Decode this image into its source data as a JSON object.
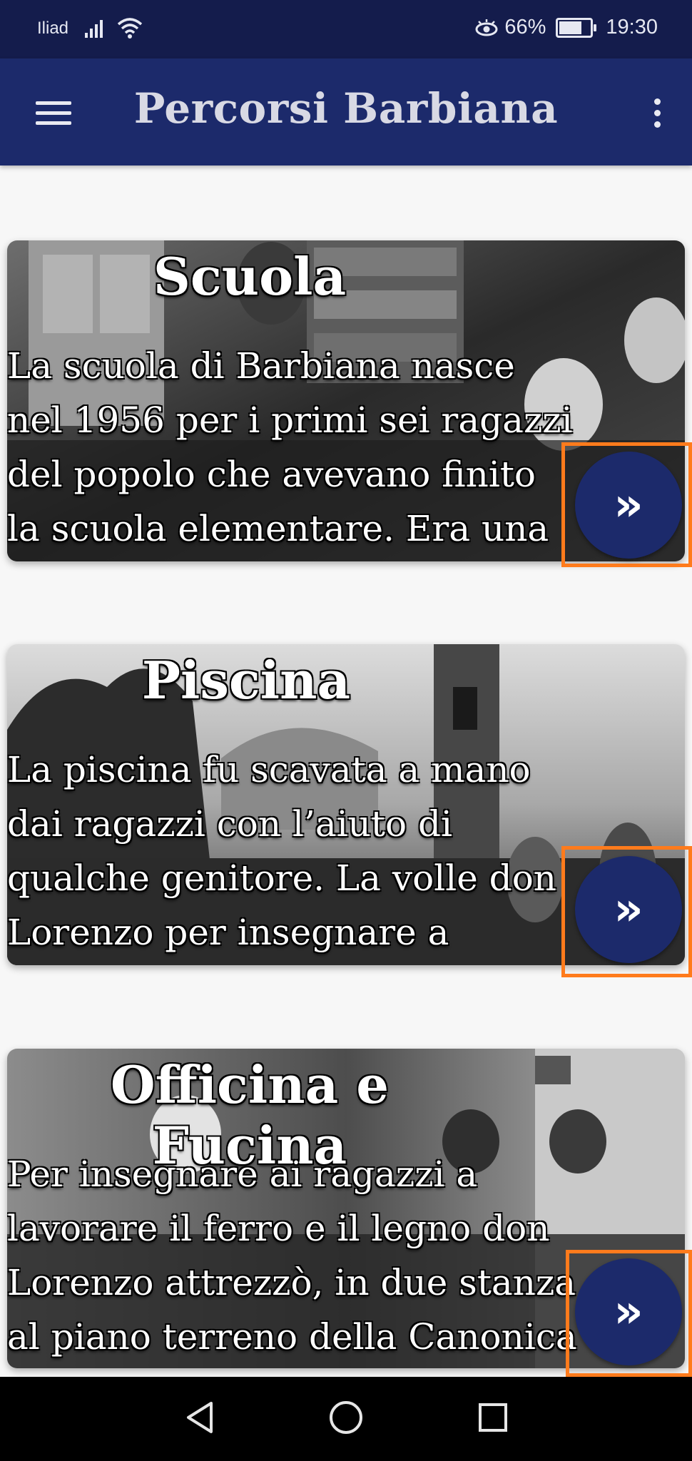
{
  "status_bar": {
    "carrier": "Iliad",
    "battery_percent": "66%",
    "battery_level": 0.66,
    "time": "19:30"
  },
  "app_bar": {
    "title": "Percorsi Barbiana"
  },
  "cards": [
    {
      "title": "Scuola",
      "text": "La scuola di Barbiana nasce nel 1956 per i primi sei ragazzi del popolo che avevano finito la scuola elementare. Era una",
      "button_label": "»"
    },
    {
      "title": "Piscina",
      "text": "La piscina fu scavata a mano dai ragazzi con l’aiuto di qualche genitore. La volle don Lorenzo per insegnare a nuotare ai",
      "button_label": "»"
    },
    {
      "title": "Officina e Fucina",
      "text": "Per insegnare ai ragazzi a lavorare il ferro e il legno don Lorenzo attrezzò, in due stanza al piano terreno della Canonica",
      "button_label": "»"
    }
  ],
  "colors": {
    "status_bar": "#141c4c",
    "app_bar": "#1c2a6b",
    "accent_button": "#1c2a6b",
    "highlight": "#ff7b1c"
  },
  "icons": {
    "menu": "hamburger-icon",
    "more": "overflow-menu-icon",
    "nav_back": "triangle-back-icon",
    "nav_home": "circle-home-icon",
    "nav_recent": "square-recent-icon"
  }
}
